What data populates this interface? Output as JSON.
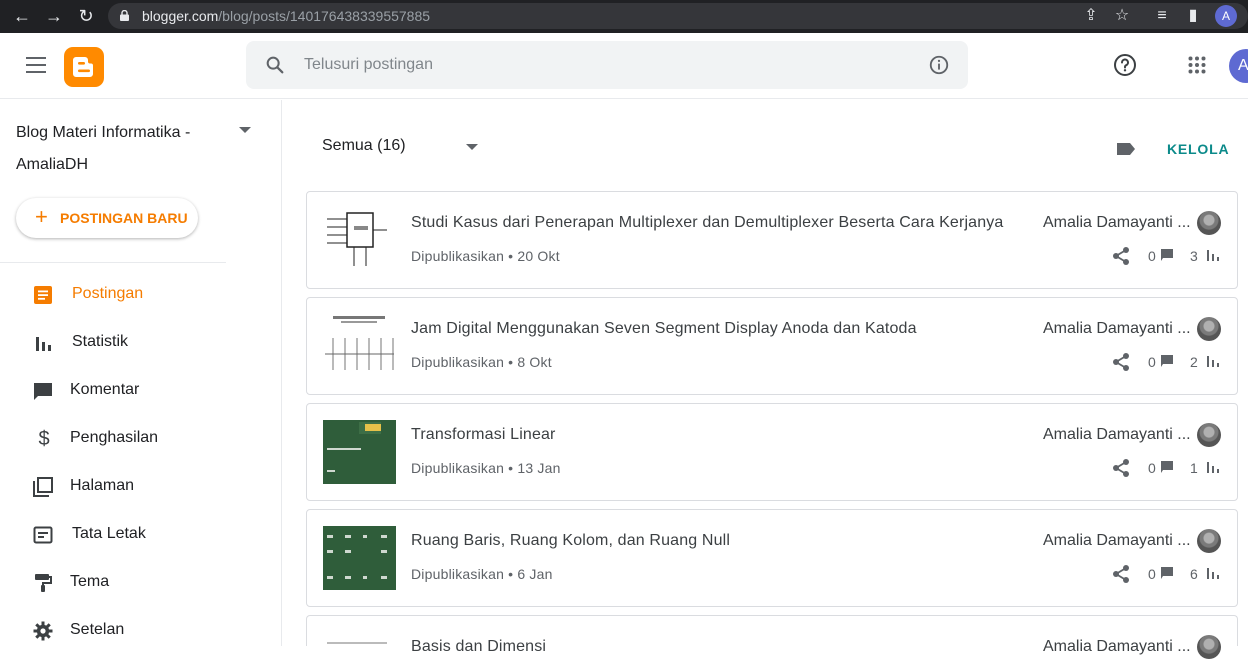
{
  "browser": {
    "url_host": "blogger.com",
    "url_path": "/blog/posts/140176438339557885",
    "profile_initial": "A"
  },
  "header": {
    "search_placeholder": "Telusuri postingan",
    "profile_initial": "A"
  },
  "sidebar": {
    "blog_name": "Blog Materi Informatika - AmaliaDH",
    "new_post_label": "POSTINGAN BARU",
    "items": [
      {
        "label": "Postingan",
        "icon": "posts-icon",
        "active": true
      },
      {
        "label": "Statistik",
        "icon": "stats-icon"
      },
      {
        "label": "Komentar",
        "icon": "comment-icon"
      },
      {
        "label": "Penghasilan",
        "icon": "dollar-icon"
      },
      {
        "label": "Halaman",
        "icon": "pages-icon"
      },
      {
        "label": "Tata Letak",
        "icon": "layout-icon"
      },
      {
        "label": "Tema",
        "icon": "paint-roller-icon"
      },
      {
        "label": "Setelan",
        "icon": "gear-icon"
      }
    ]
  },
  "main": {
    "filter_label": "Semua (16)",
    "manage_label": "KELOLA",
    "posts": [
      {
        "title": "Studi Kasus dari Penerapan Multiplexer dan Demultiplexer Beserta Cara Kerjanya",
        "meta": "Dipublikasikan • 20 Okt",
        "author": "Amalia Damayanti ...",
        "comments": "0",
        "views": "3"
      },
      {
        "title": "Jam Digital Menggunakan Seven Segment Display Anoda dan Katoda",
        "meta": "Dipublikasikan • 8 Okt",
        "author": "Amalia Damayanti ...",
        "comments": "0",
        "views": "2"
      },
      {
        "title": "Transformasi Linear",
        "meta": "Dipublikasikan • 13 Jan",
        "author": "Amalia Damayanti ...",
        "comments": "0",
        "views": "1"
      },
      {
        "title": "Ruang Baris, Ruang Kolom, dan Ruang Null",
        "meta": "Dipublikasikan • 6 Jan",
        "author": "Amalia Damayanti ...",
        "comments": "0",
        "views": "6"
      },
      {
        "title": "Basis dan Dimensi",
        "meta": "",
        "author": "Amalia Damayanti ...",
        "comments": "",
        "views": ""
      }
    ]
  },
  "colors": {
    "accent": "#f57c00",
    "manage": "#0b8a8a",
    "chrome_bg": "#202124"
  }
}
